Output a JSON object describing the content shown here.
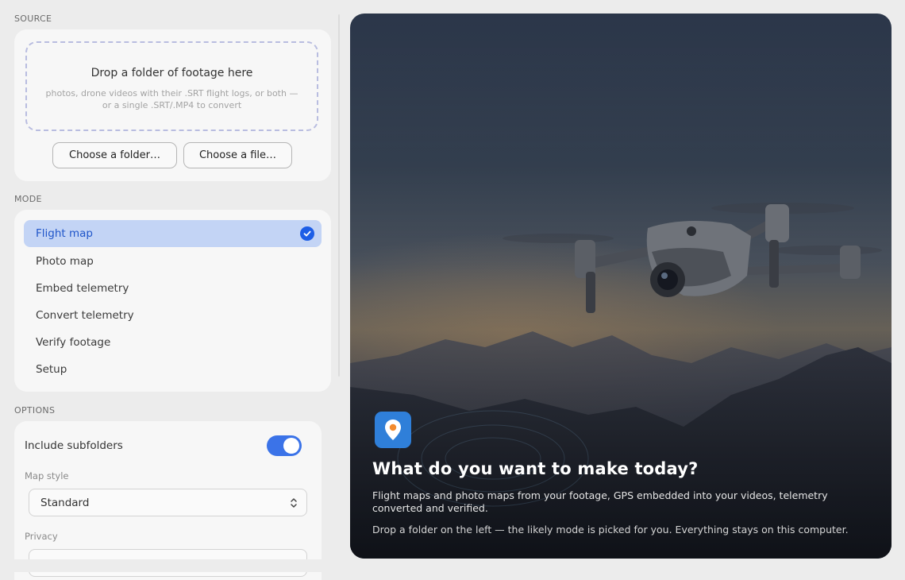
{
  "source": {
    "section_label": "SOURCE",
    "drop_title": "Drop a folder of footage here",
    "drop_subtitle": "photos, drone videos with their .SRT flight logs, or both — or a single .SRT/.MP4 to convert",
    "choose_folder": "Choose a folder…",
    "choose_file": "Choose a file…"
  },
  "mode": {
    "section_label": "MODE",
    "selected": "Flight map",
    "items": [
      {
        "label": "Flight map"
      },
      {
        "label": "Photo map"
      },
      {
        "label": "Embed telemetry"
      },
      {
        "label": "Convert telemetry"
      },
      {
        "label": "Verify footage"
      },
      {
        "label": "Setup"
      }
    ]
  },
  "options": {
    "section_label": "OPTIONS",
    "include_subfolders": "Include subfolders",
    "include_subfolders_on": true,
    "map_style_label": "Map style",
    "map_style_value": "Standard",
    "privacy_label": "Privacy"
  },
  "hero": {
    "title": "What do you want to make today?",
    "paragraph1": "Flight maps and photo maps from your footage, GPS embedded into your videos, telemetry converted and verified.",
    "paragraph2": "Drop a folder on the left — the likely mode is picked for you. Everything stays on this computer.",
    "app_icon": "map-pin-icon"
  },
  "colors": {
    "accent": "#1d5ee6",
    "selected_bg": "#c3d4f5",
    "toggle_on": "#3b73e8"
  }
}
